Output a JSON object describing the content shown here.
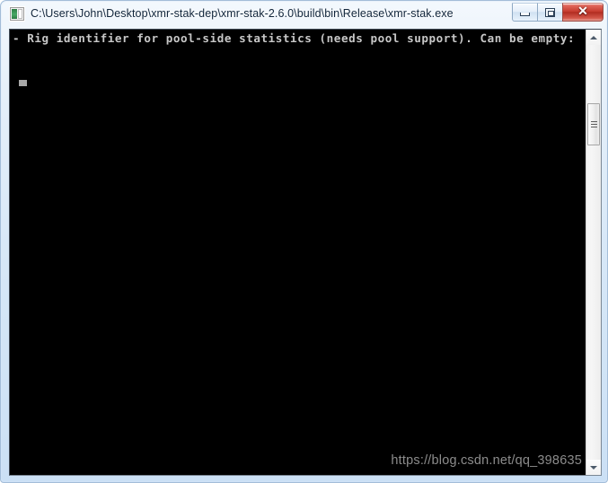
{
  "window": {
    "title": "C:\\Users\\John\\Desktop\\xmr-stak-dep\\xmr-stak-2.6.0\\build\\bin\\Release\\xmr-stak.exe",
    "icon": "console-app-icon",
    "controls": {
      "minimize_label": "",
      "maximize_label": "",
      "close_label": "✕"
    }
  },
  "console": {
    "lines": [
      "- Rig identifier for pool-side statistics (needs pool support). Can be empty:"
    ],
    "text": "- Rig identifier for pool-side statistics (needs pool support). Can be empty:",
    "cursor": "block-cursor",
    "foreground_color": "#c8c8c8",
    "background_color": "#000000"
  },
  "watermark": {
    "text": "https://blog.csdn.net/qq_398635"
  },
  "scrollbar": {
    "up_arrow": "▲",
    "down_arrow": "▼",
    "thumb": "scroll-thumb"
  }
}
